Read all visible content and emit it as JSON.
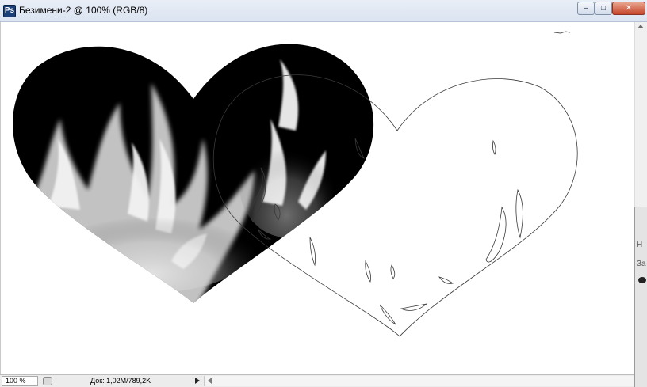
{
  "window": {
    "title": "Безимени-2 @ 100% (RGB/8)",
    "app_icon": "photoshop-icon",
    "controls": {
      "minimize": "–",
      "maximize": "□",
      "close": "✕"
    }
  },
  "canvas": {
    "background": "#ffffff",
    "layers": [
      "filled heart with fire texture",
      "heart outline"
    ]
  },
  "side_panel": {
    "rows": [
      "Н",
      "За"
    ]
  },
  "statusbar": {
    "zoom": "100 %",
    "doc_info": "Док: 1,02M/789,2K"
  },
  "colors": {
    "titlebar": "#dbe4f1",
    "close_button": "#c5452a",
    "heart_fill": "#000000"
  }
}
